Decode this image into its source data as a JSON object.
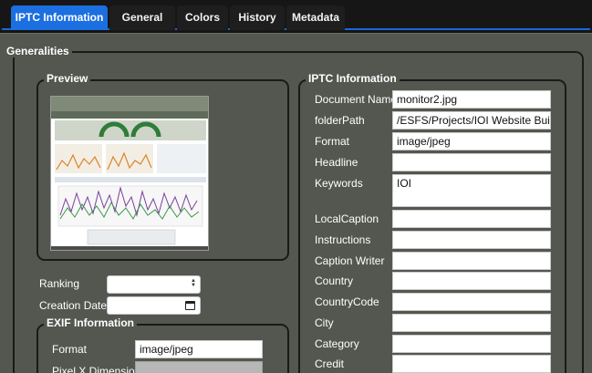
{
  "tabs": [
    {
      "label": "IPTC Information",
      "active": true
    },
    {
      "label": "General",
      "active": false
    },
    {
      "label": "Colors",
      "active": false
    },
    {
      "label": "History",
      "active": false
    },
    {
      "label": "Metadata",
      "active": false
    }
  ],
  "generalities": {
    "title": "Generalities",
    "preview_title": "Preview",
    "ranking_label": "Ranking",
    "ranking_value": "",
    "creation_date_label": "Creation Date",
    "creation_date_value": ""
  },
  "exif": {
    "title": "EXIF Information",
    "format_label": "Format",
    "format_value": "image/jpeg",
    "pixel_x_label": "Pixel X Dimension",
    "pixel_x_value": ""
  },
  "iptc": {
    "title": "IPTC Information",
    "fields": [
      {
        "label": "Document Name",
        "value": "monitor2.jpg"
      },
      {
        "label": "folderPath",
        "value": "/ESFS/Projects/IOI Website Build"
      },
      {
        "label": "Format",
        "value": "image/jpeg"
      },
      {
        "label": "Headline",
        "value": ""
      },
      {
        "label": "Keywords",
        "value": "IOI"
      },
      {
        "label": "LocalCaption",
        "value": ""
      },
      {
        "label": "Instructions",
        "value": ""
      },
      {
        "label": "Caption Writer",
        "value": ""
      },
      {
        "label": "Country",
        "value": ""
      },
      {
        "label": "CountryCode",
        "value": ""
      },
      {
        "label": "City",
        "value": ""
      },
      {
        "label": "Category",
        "value": ""
      },
      {
        "label": "Credit",
        "value": ""
      }
    ]
  },
  "colors": {
    "accent": "#1b6fe0",
    "panel": "#53574f",
    "tabbar": "#161616"
  },
  "icons": {
    "select_arrows": "updown-arrows-icon",
    "calendar": "calendar-icon"
  }
}
